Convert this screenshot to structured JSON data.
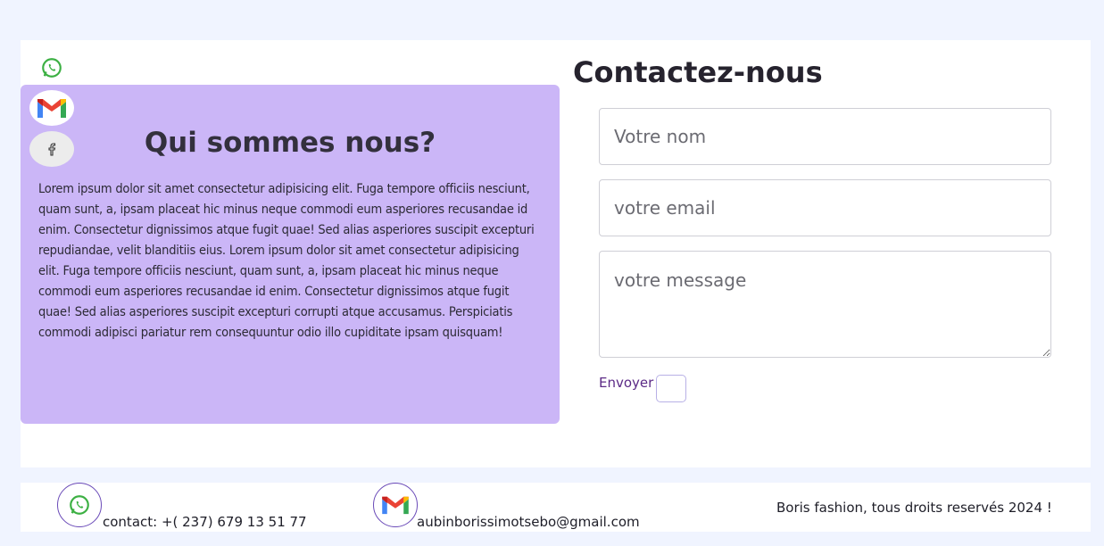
{
  "about": {
    "title": "Qui sommes nous?",
    "text": "Lorem ipsum dolor sit amet consectetur adipisicing elit. Fuga tempore officiis nesciunt, quam sunt, a, ipsam placeat hic minus neque commodi eum asperiores recusandae id enim. Consectetur dignissimos atque fugit quae! Sed alias asperiores suscipit excepturi repudiandae, velit blanditiis eius. Lorem ipsum dolor sit amet consectetur adipisicing elit. Fuga tempore officiis nesciunt, quam sunt, a, ipsam placeat hic minus neque commodi eum asperiores recusandae id enim. Consectetur dignissimos atque fugit quae! Sed alias asperiores suscipit excepturi corrupti atque accusamus. Perspiciatis commodi adipisci pariatur rem consequuntur odio illo cupiditate ipsam quisquam!"
  },
  "social": {
    "icons": [
      "whatsapp-icon",
      "gmail-icon",
      "facebook-icon"
    ]
  },
  "contact": {
    "title": "Contactez-nous",
    "name_placeholder": "Votre nom",
    "email_placeholder": "votre email",
    "message_placeholder": "votre message",
    "send_label": "Envoyer"
  },
  "footer": {
    "phone": "contact: +( 237) 679 13 51 77",
    "email": "aubinborissimotsebo@gmail.com",
    "copyright": "Boris fashion, tous droits reservés 2024 !"
  },
  "colors": {
    "page_bg": "#f0f4ff",
    "about_bg": "#cbb6f7",
    "accent": "#5b2a86"
  }
}
